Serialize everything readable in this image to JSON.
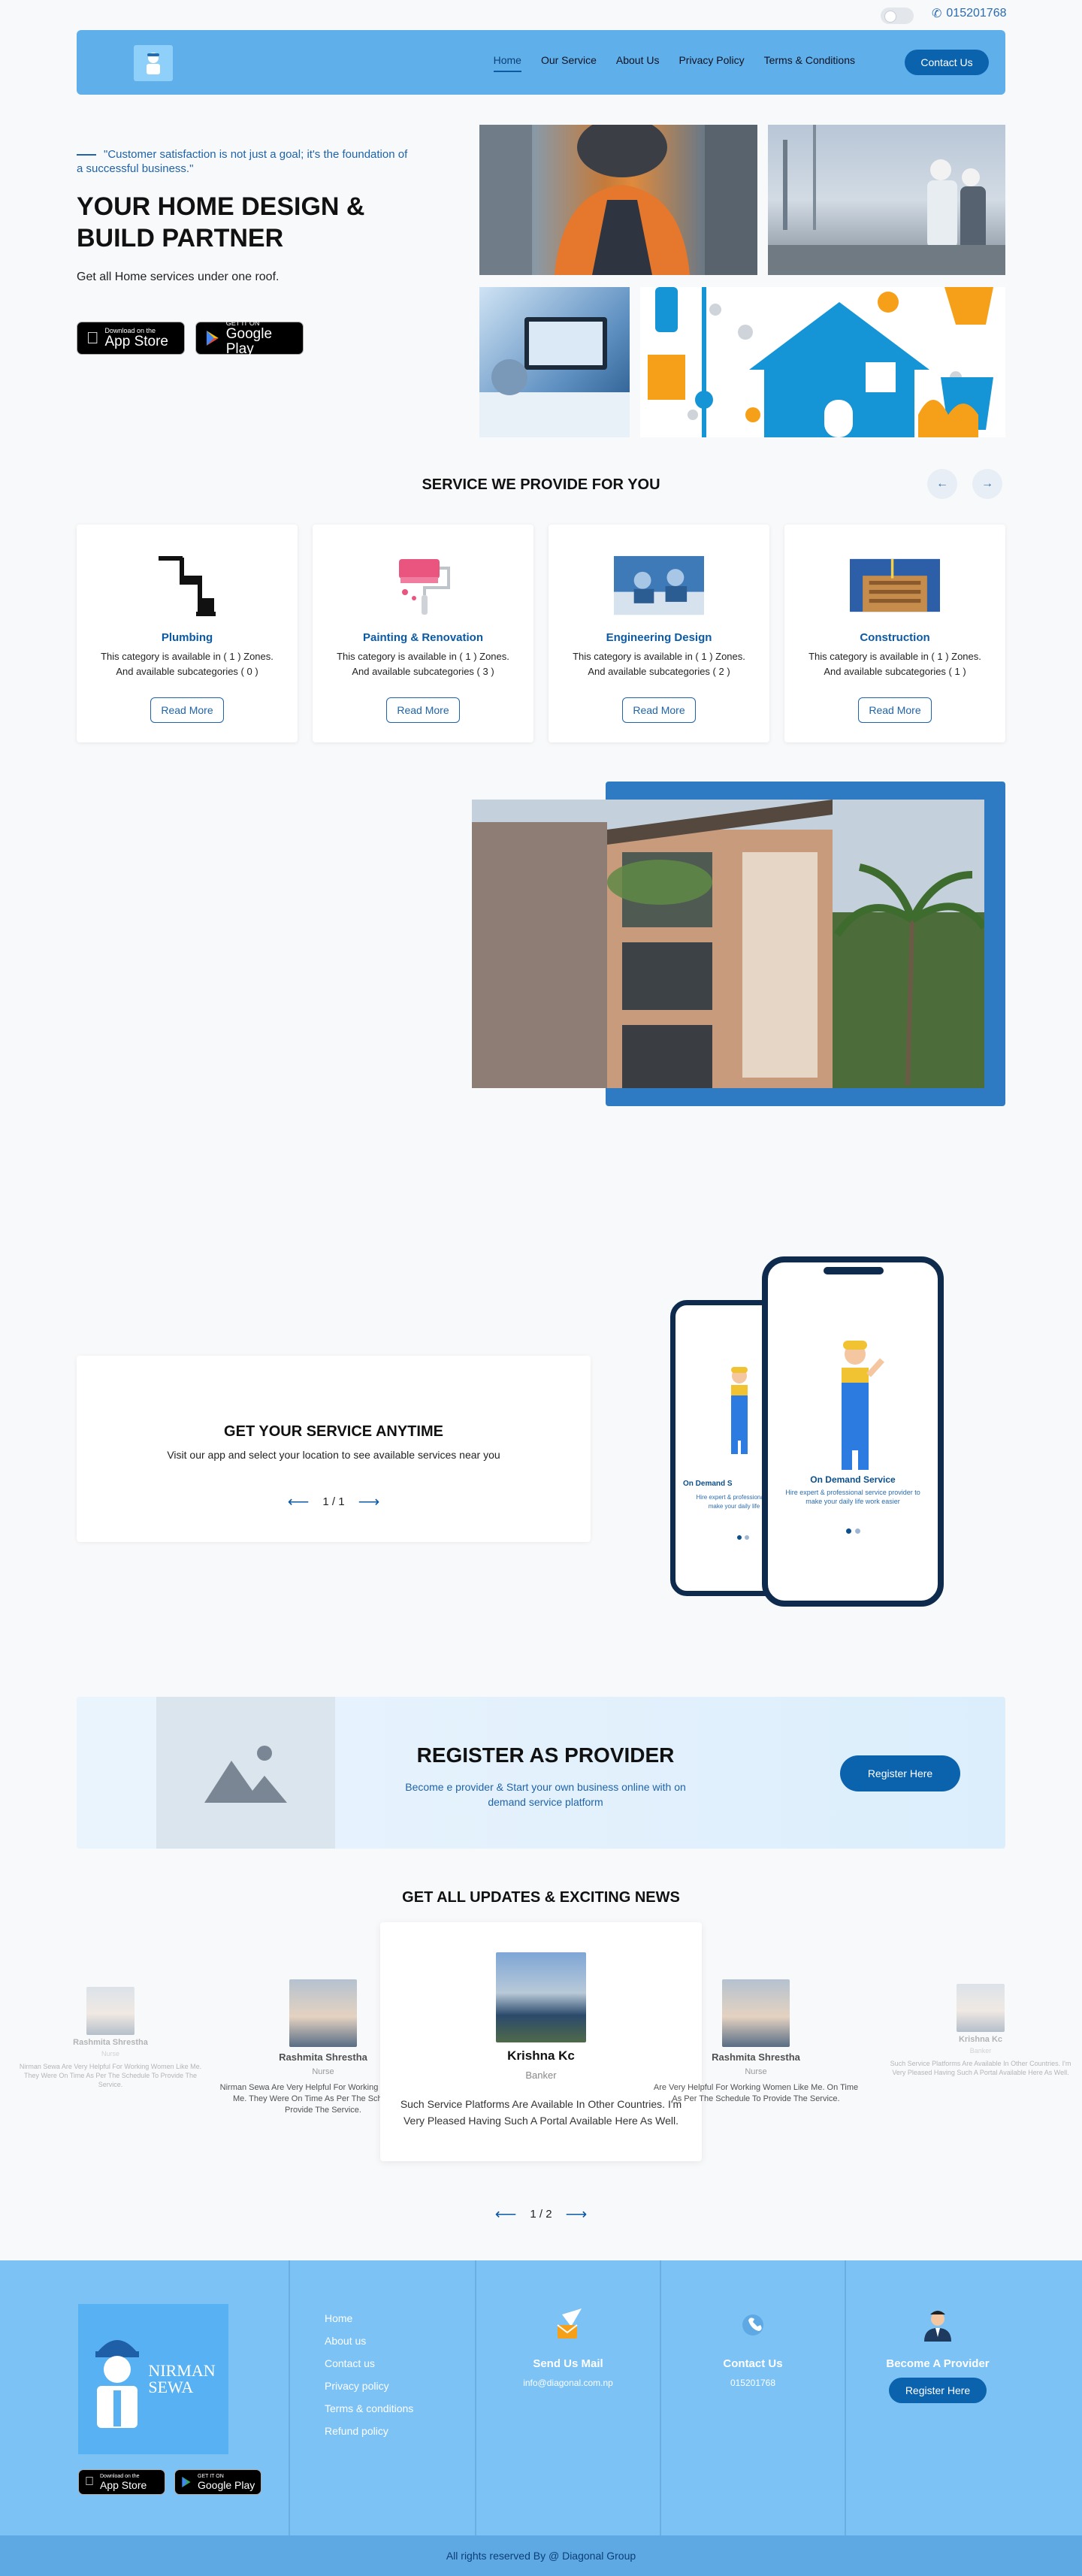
{
  "topbar": {
    "phone": "015201768"
  },
  "nav": {
    "items": [
      "Home",
      "Our Service",
      "About Us",
      "Privacy Policy",
      "Terms & Conditions"
    ],
    "contact": "Contact Us"
  },
  "hero": {
    "quote": "\"Customer satisfaction is not just a goal; it's the foundation of a successful business.\"",
    "title": "YOUR HOME DESIGN & BUILD PARTNER",
    "subtitle": "Get all Home services under one roof.",
    "appstore": {
      "small": "Download on the",
      "big": "App Store"
    },
    "playstore": {
      "small": "GET IT ON",
      "big": "Google Play"
    }
  },
  "services": {
    "title": "SERVICE WE PROVIDE FOR YOU",
    "cards": [
      {
        "name": "Plumbing",
        "desc": "This category is available in ( 1 ) Zones. And available subcategories ( 0 )",
        "button": "Read More"
      },
      {
        "name": "Painting & Renovation",
        "desc": "This category is available in ( 1 ) Zones. And available subcategories ( 3 )",
        "button": "Read More"
      },
      {
        "name": "Engineering Design",
        "desc": "This category is available in ( 1 ) Zones. And available subcategories ( 2 )",
        "button": "Read More"
      },
      {
        "name": "Construction",
        "desc": "This category is available in ( 1 ) Zones. And available subcategories ( 1 )",
        "button": "Read More"
      }
    ]
  },
  "anytime": {
    "title": "GET YOUR SERVICE ANYTIME",
    "desc": "Visit our app and select your location to see available services near you",
    "pager": "1 / 1",
    "phone_title": "On Demand Service",
    "phone_desc": "Hire expert & professional service provider to make your daily life work easier",
    "phone_title_cut": "On Demand S",
    "phone_desc_cut": "Hire expert & professional to make your daily life"
  },
  "register": {
    "title": "REGISTER AS PROVIDER",
    "desc": "Become e provider & Start your own business online with on demand service platform",
    "button": "Register Here"
  },
  "news": {
    "title": "GET ALL UPDATES & EXCITING NEWS",
    "pager": "1 / 2",
    "testimonials": [
      {
        "name": "Rashmita Shrestha",
        "role": "Nurse",
        "text": "Nirman Sewa Are Very Helpful For Working Women Like Me. They Were On Time As Per The Schedule To Provide The Service."
      },
      {
        "name": "Rashmita Shrestha",
        "role": "Nurse",
        "text": "Nirman Sewa Are Very Helpful For Working Women Like Me. They Were On Time As Per The Schedule To Provide The Service."
      },
      {
        "name": "Krishna Kc",
        "role": "Banker",
        "text": "Such Service Platforms Are Available In Other Countries. I'm Very Pleased Having Such A Portal Available Here As Well."
      },
      {
        "name": "Rashmita Shrestha",
        "role": "Nurse",
        "text": "Are Very Helpful For Working Women Like Me. On Time As Per The Schedule To Provide The Service."
      },
      {
        "name": "Krishna Kc",
        "role": "Banker",
        "text": "Such Service Platforms Are Available In Other Countries. I'm Very Pleased Having Such A Portal Available Here As Well."
      }
    ]
  },
  "footer": {
    "brand": {
      "line1": "NIRMAN",
      "line2": "SEWA"
    },
    "links": [
      "Home",
      "About us",
      "Contact us",
      "Privacy policy",
      "Terms & conditions",
      "Refund policy"
    ],
    "mail": {
      "title": "Send Us Mail",
      "value": "info@diagonal.com.np"
    },
    "contact": {
      "title": "Contact Us",
      "value": "015201768"
    },
    "provider": {
      "title": "Become A Provider",
      "button": "Register Here"
    },
    "copyright": "All rights reserved By @ Diagonal Group"
  },
  "colors": {
    "primary": "#0b62ad",
    "header": "#5fb0ea",
    "footer": "#7cc2f4",
    "accent_text": "#1f63a8"
  }
}
